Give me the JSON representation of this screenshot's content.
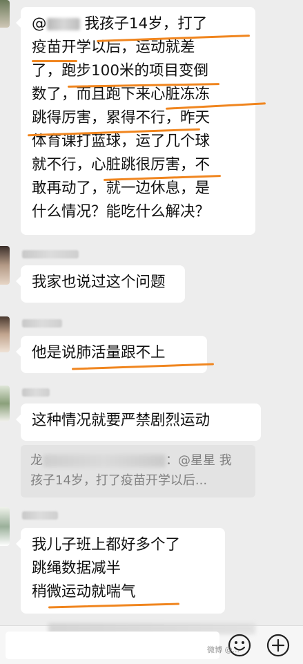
{
  "messages": [
    {
      "lines": [
        "我孩子14岁，打了",
        "疫苗开学以后，运动就差",
        "了，跑步100米的项目变倒",
        "数了，而且跑下来心脏冻冻",
        "跳得厉害，累得不行，昨天",
        "体育课打蓝球，运了几个球",
        "就不行，心脏跳很厉害，不",
        "敢再动了，就一边休息，是",
        "什么情况？能吃什么解决？"
      ],
      "mention_prefix": "@"
    },
    {
      "lines": [
        "我家也说过这个问题"
      ]
    },
    {
      "lines": [
        "他是说肺活量跟不上"
      ]
    },
    {
      "lines": [
        "这种情况就要严禁剧烈运动"
      ],
      "quote": {
        "prefix": "龙",
        "tail": "：@星星 我",
        "line2": "孩子14岁，打了疫苗开学以后..."
      }
    },
    {
      "lines": [
        "我儿子班上都好多个了",
        "跳绳数据减半",
        "稍微运动就喘气"
      ]
    }
  ],
  "toolbar": {
    "emoji_icon": "emoji-icon",
    "plus_icon": "plus-circle-icon"
  },
  "watermark": "微博 @..."
}
